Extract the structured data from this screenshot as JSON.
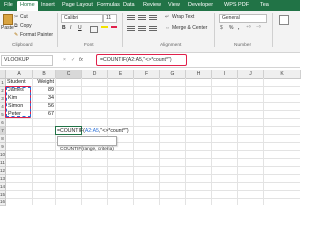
{
  "ribbon_tabs": [
    "File",
    "Home",
    "Insert",
    "Page Layout",
    "Formulas",
    "Data",
    "Review",
    "View",
    "Developer",
    "WPS PDF",
    "Tea"
  ],
  "active_tab": "Home",
  "clipboard": {
    "cut": "Cut",
    "copy": "Copy",
    "format_painter": "Format Painter",
    "group": "Clipboard",
    "paste": "Paste"
  },
  "font": {
    "name": "Calibri",
    "size": "11",
    "bold": "B",
    "italic": "I",
    "underline": "U",
    "group": "Font"
  },
  "alignment": {
    "wrap_text": "Wrap Text",
    "merge": "Merge & Center",
    "group": "Alignment"
  },
  "number": {
    "format": "General",
    "percent": "%",
    "comma": ",",
    "group": "Number"
  },
  "formula_bar": {
    "name_box": "VLOOKUP",
    "cancel": "×",
    "enter": "✓",
    "fx": "fx",
    "formula": "=COUNTIF(A2:A5,\"<>*count*\")"
  },
  "columns": [
    "A",
    "B",
    "C",
    "D",
    "E",
    "F",
    "G",
    "H",
    "I",
    "J",
    "K"
  ],
  "rows": [
    "1",
    "2",
    "3",
    "4",
    "5",
    "6",
    "7",
    "8",
    "9",
    "10",
    "11",
    "12",
    "13",
    "14",
    "15",
    "16"
  ],
  "cells": {
    "A1": "Student",
    "B1": "Weight",
    "A2": "James",
    "B2": "89",
    "A3": "Kim",
    "B3": "34",
    "A4": "Simon",
    "B4": "56",
    "A5": "Peter",
    "B5": "67",
    "C7_prefix": "=COUNTIF(",
    "C7_range": "A2:A5",
    "C7_suffix": ",\"<>*count*\")"
  },
  "tooltip": "COUNTIF(range, criteria)",
  "colors": {
    "excel_green": "#217346",
    "highlight": "#e0204a",
    "range_blue": "#2a6fd6"
  }
}
